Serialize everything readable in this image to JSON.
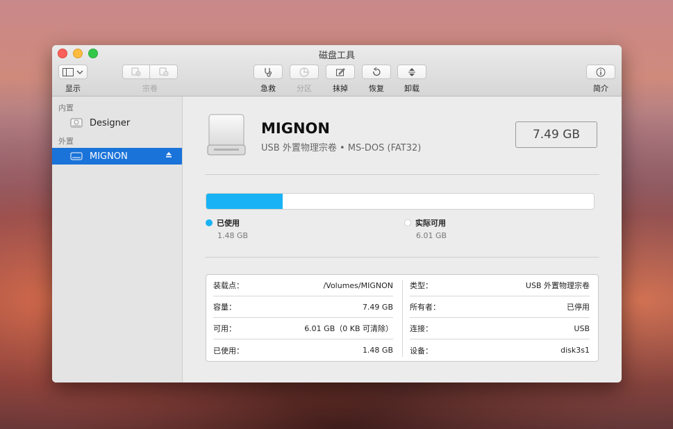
{
  "window": {
    "title": "磁盘工具"
  },
  "toolbar": {
    "view_label": "显示",
    "volume_label": "宗卷",
    "first_aid_label": "急救",
    "partition_label": "分区",
    "erase_label": "抹掉",
    "restore_label": "恢复",
    "unmount_label": "卸载",
    "info_label": "简介"
  },
  "sidebar": {
    "internal_header": "内置",
    "external_header": "外置",
    "internal_items": [
      {
        "label": "Designer"
      }
    ],
    "external_items": [
      {
        "label": "MIGNON",
        "selected": true
      }
    ]
  },
  "volume": {
    "name": "MIGNON",
    "description": "USB 外置物理宗卷 • MS-DOS (FAT32)",
    "capacity": "7.49 GB"
  },
  "usage": {
    "used_fraction": 0.197,
    "used_label": "已使用",
    "used_value": "1.48 GB",
    "free_label": "实际可用",
    "free_value": "6.01 GB",
    "used_color": "#19b3f5",
    "free_color": "#ffffff"
  },
  "info": {
    "left": [
      {
        "key": "装载点：",
        "value": "/Volumes/MIGNON"
      },
      {
        "key": "容量：",
        "value": "7.49 GB"
      },
      {
        "key": "可用：",
        "value": "6.01 GB（0 KB 可清除）"
      },
      {
        "key": "已使用：",
        "value": "1.48 GB"
      }
    ],
    "right": [
      {
        "key": "类型：",
        "value": "USB 外置物理宗卷"
      },
      {
        "key": "所有者：",
        "value": "已停用"
      },
      {
        "key": "连接：",
        "value": "USB"
      },
      {
        "key": "设备：",
        "value": "disk3s1"
      }
    ]
  },
  "colors": {
    "selection": "#1a73d9",
    "accent": "#19b3f5"
  }
}
